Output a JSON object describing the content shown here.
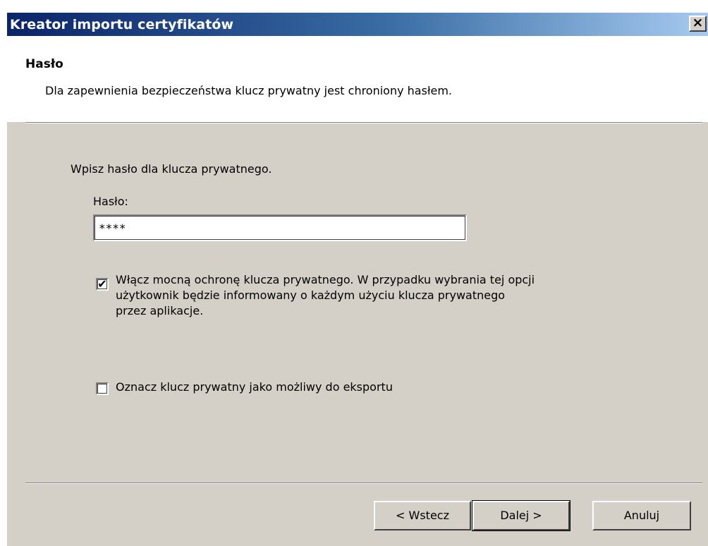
{
  "window": {
    "title": "Kreator importu certyfikatów",
    "close_label": "×"
  },
  "header": {
    "title": "Hasło",
    "description": "Dla zapewnienia bezpieczeństwa klucz prywatny jest chroniony hasłem."
  },
  "form": {
    "instruction": "Wpisz hasło dla klucza prywatnego.",
    "password_label": "Hasło:",
    "password_value": "****",
    "strong_protection": {
      "checked": true,
      "label": "Włącz mocną ochronę klucza prywatnego. W przypadku wybrania tej opcji użytkownik będzie informowany o każdym użyciu klucza prywatnego przez aplikacje."
    },
    "exportable": {
      "checked": false,
      "label": "Oznacz klucz prywatny jako możliwy do eksportu"
    }
  },
  "buttons": {
    "back": "< Wstecz",
    "next": "Dalej >",
    "cancel": "Anuluj"
  },
  "checkmark": "✔"
}
